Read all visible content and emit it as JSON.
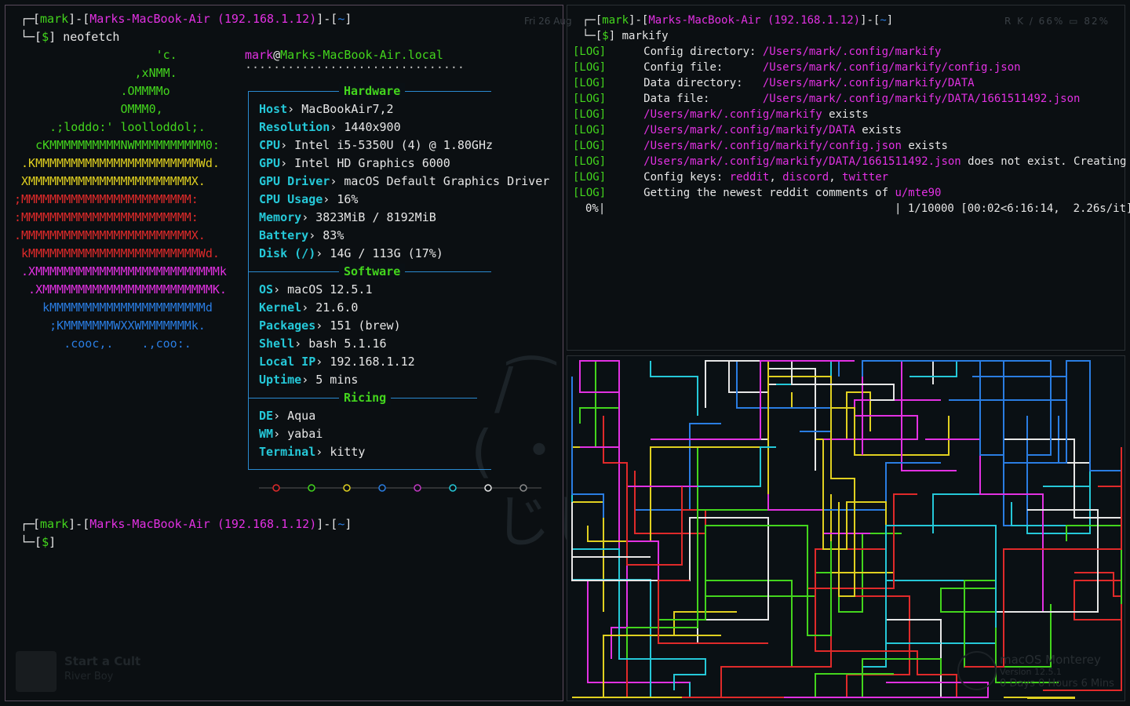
{
  "menubar": {
    "clock": "Fri 26 Aug",
    "stats": "R K  / 66%  ▭ 82%"
  },
  "left": {
    "prompt1": {
      "user": "mark",
      "host": "Marks-MacBook-Air",
      "ip": "(192.168.1.12)",
      "dir": "~",
      "cmd": "neofetch"
    },
    "logo": [
      "                    'c.",
      "                 ,xNMM.",
      "               .OMMMMo",
      "               OMMM0,",
      "     .;loddo:' loolloddol;.",
      "   cKMMMMMMMMMMNWMMMMMMMMMM0:",
      " .KMMMMMMMMMMMMMMMMMMMMMMMWd.",
      " XMMMMMMMMMMMMMMMMMMMMMMMX.",
      ";MMMMMMMMMMMMMMMMMMMMMMMM:",
      ":MMMMMMMMMMMMMMMMMMMMMMMM:",
      ".MMMMMMMMMMMMMMMMMMMMMMMMX.",
      " kMMMMMMMMMMMMMMMMMMMMMMMMWd.",
      " .XMMMMMMMMMMMMMMMMMMMMMMMMMMk",
      "  .XMMMMMMMMMMMMMMMMMMMMMMMMK.",
      "    kMMMMMMMMMMMMMMMMMMMMMMd",
      "     ;KMMMMMMMWXXWMMMMMMMk.",
      "       .cooc,.    .,coo:."
    ],
    "userhost": {
      "user": "mark",
      "at": "@",
      "host": "Marks-MacBook-Air.local",
      "rule": "·······························"
    },
    "sections": {
      "hardware": "Hardware",
      "software": "Software",
      "ricing": "Ricing"
    },
    "hardware": [
      {
        "k": "Host",
        "v": "MacBookAir7,2"
      },
      {
        "k": "Resolution",
        "v": "1440x900"
      },
      {
        "k": "CPU",
        "v": "Intel i5-5350U (4) @ 1.80GHz"
      },
      {
        "k": "GPU",
        "v": "Intel HD Graphics 6000"
      },
      {
        "k": "GPU Driver",
        "v": "macOS Default Graphics Driver"
      },
      {
        "k": "CPU Usage",
        "v": "16%"
      },
      {
        "k": "Memory",
        "v": "3823MiB / 8192MiB"
      },
      {
        "k": "Battery",
        "v": "83%"
      },
      {
        "k": "Disk (/)",
        "v": "14G / 113G (17%)"
      }
    ],
    "software": [
      {
        "k": "OS",
        "v": "macOS 12.5.1"
      },
      {
        "k": "Kernel",
        "v": "21.6.0"
      },
      {
        "k": "Packages",
        "v": "151 (brew)"
      },
      {
        "k": "Shell",
        "v": "bash 5.1.16"
      },
      {
        "k": "Local IP",
        "v": "192.168.1.12"
      },
      {
        "k": "Uptime",
        "v": "5 mins"
      }
    ],
    "ricing": [
      {
        "k": "DE",
        "v": "Aqua"
      },
      {
        "k": "WM",
        "v": "yabai"
      },
      {
        "k": "Terminal",
        "v": "kitty"
      }
    ],
    "sep": "›",
    "palette": [
      "#e02a2a",
      "#43d51d",
      "#e0d020",
      "#2a7de2",
      "#c238c2",
      "#25c8d8",
      "#e6e6e6",
      "#8a8a8a"
    ],
    "prompt2": {
      "user": "mark",
      "host": "Marks-MacBook-Air",
      "ip": "(192.168.1.12)",
      "dir": "~"
    }
  },
  "right": {
    "prompt": {
      "user": "mark",
      "host": "Marks-MacBook-Air",
      "ip": "(192.168.1.12)",
      "dir": "~",
      "cmd": "markify"
    },
    "logs": [
      {
        "tag": "[LOG]",
        "label": "Config directory: ",
        "path": "/Users/mark/.config/markify",
        "tail": ""
      },
      {
        "tag": "[LOG]",
        "label": "Config file:      ",
        "path": "/Users/mark/.config/markify/config.json",
        "tail": ""
      },
      {
        "tag": "[LOG]",
        "label": "Data directory:   ",
        "path": "/Users/mark/.config/markify/DATA",
        "tail": ""
      },
      {
        "tag": "[LOG]",
        "label": "Data file:        ",
        "path": "/Users/mark/.config/markify/DATA/1661511492.json",
        "tail": ""
      },
      {
        "tag": "[LOG]",
        "label": "",
        "path": "/Users/mark/.config/markify",
        "tail": " exists"
      },
      {
        "tag": "[LOG]",
        "label": "",
        "path": "/Users/mark/.config/markify/DATA",
        "tail": " exists"
      },
      {
        "tag": "[LOG]",
        "label": "",
        "path": "/Users/mark/.config/markify/config.json",
        "tail": " exists"
      },
      {
        "tag": "[LOG]",
        "label": "",
        "path": "/Users/mark/.config/markify/DATA/1661511492.json",
        "tail": " does not exist. Creating it"
      }
    ],
    "keys": {
      "tag": "[LOG]",
      "label": "Config keys: ",
      "k1": "reddit",
      "k2": "discord",
      "k3": "twitter"
    },
    "getting": {
      "tag": "[LOG]",
      "label": "Getting the newest reddit comments of ",
      "user": "u/mte90"
    },
    "progress": {
      "pct": "0%|",
      "stats": "| 1/10000 [00:02<6:16:14,  2.26s/it]"
    }
  },
  "widgets": {
    "nowplaying": {
      "title": "Start a Cult",
      "artist": "River Boy"
    },
    "os": {
      "name": "macOS Monterey",
      "version": "Version 12.5.1",
      "uptime": "0 Days 0 Hours 6 Mins"
    },
    "watermark": "/ ͡ ̄\n(・_・)\nじしし"
  },
  "pipes": {
    "colors": [
      "#43d51d",
      "#e6e6e6",
      "#2a7de2",
      "#e0d020",
      "#e231e2",
      "#25c8d8",
      "#e02a2a"
    ]
  }
}
